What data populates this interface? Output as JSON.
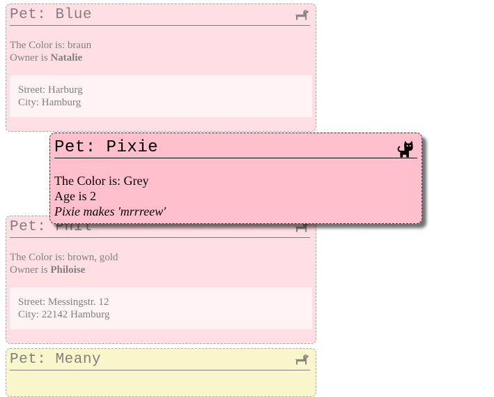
{
  "cards": [
    {
      "title": "Pet: Blue",
      "icon": "dog-icon",
      "color_line": "The Color is: braun",
      "owner_prefix": "Owner is ",
      "owner_name": "Natalie",
      "street": "Street: Harburg",
      "city": "City: Hamburg"
    },
    {
      "title": "Pet: Phil",
      "icon": "dog-icon",
      "color_line": "The Color is: brown, gold",
      "owner_prefix": "Owner is ",
      "owner_name": "Philoise",
      "street": "Street: Messingstr. 12",
      "city": "City: 22142 Hamburg"
    },
    {
      "title": "Pet: Meany",
      "icon": "dog-icon"
    }
  ],
  "focused": {
    "title": "Pet: Pixie",
    "icon": "cat-icon",
    "color_line": "The Color is: Grey",
    "age_line": "Age is 2",
    "sound_line": "Pixie makes 'mrrreew'"
  },
  "colors": {
    "dog_card_bg": "#ffc0cb",
    "meany_card_bg": "#f7ee9a",
    "address_bg": "#ffe8ec",
    "cat_card_bg": "#ffbfcc"
  }
}
